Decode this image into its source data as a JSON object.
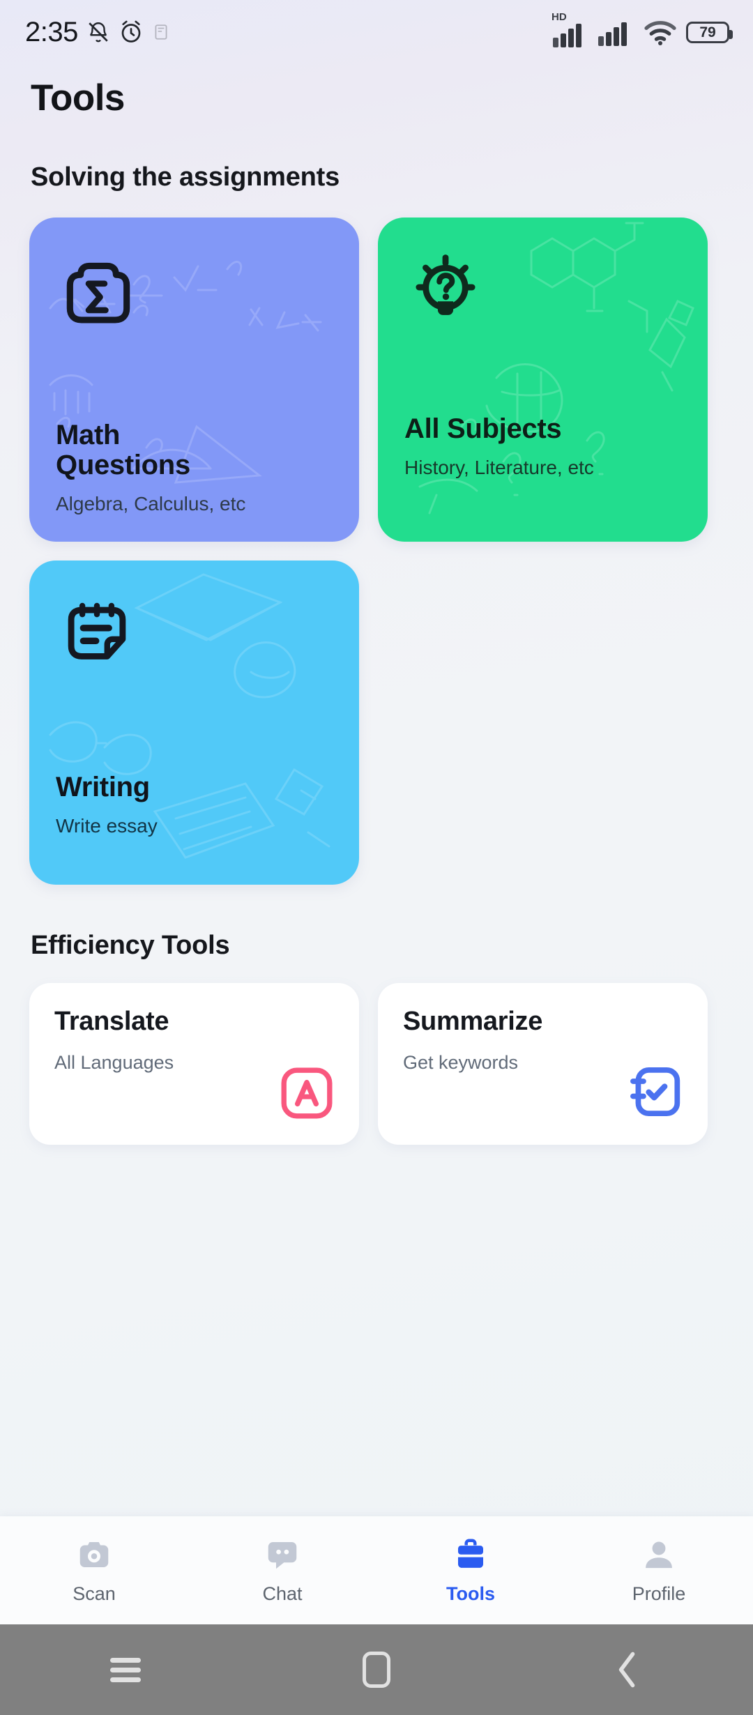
{
  "status_bar": {
    "time": "2:35",
    "icons_left": [
      "mute-icon",
      "alarm-icon",
      "screenshot-icon"
    ],
    "network_label": "HD",
    "icons_right": [
      "signal-icon",
      "signal-icon",
      "wifi-icon"
    ],
    "battery_level": "79"
  },
  "header": {
    "title": "Tools"
  },
  "sections": {
    "solving": {
      "title": "Solving the assignments"
    },
    "efficiency": {
      "title": "Efficiency Tools"
    }
  },
  "tool_cards": [
    {
      "title": "Math Questions",
      "title_line1": "Math",
      "title_line2": "Questions",
      "subtitle": "Algebra, Calculus, etc",
      "icon": "camera-sigma-icon",
      "color": "#8298f7"
    },
    {
      "title": "All Subjects",
      "subtitle": "History, Literature, etc",
      "icon": "lightbulb-question-icon",
      "color": "#22dd8e"
    },
    {
      "title": "Writing",
      "subtitle": "Write essay",
      "icon": "notepad-icon",
      "color": "#51c9f8"
    }
  ],
  "efficiency_cards": [
    {
      "title": "Translate",
      "subtitle": "All Languages",
      "icon": "letter-a-box-icon",
      "color": "#f9577e"
    },
    {
      "title": "Summarize",
      "subtitle": "Get keywords",
      "icon": "notebook-check-icon",
      "color": "#4b72ef"
    }
  ],
  "bottom_tabs": [
    {
      "label": "Scan",
      "icon": "camera-icon",
      "active": false
    },
    {
      "label": "Chat",
      "icon": "chat-bubble-icon",
      "active": false
    },
    {
      "label": "Tools",
      "icon": "toolbox-icon",
      "active": true
    },
    {
      "label": "Profile",
      "icon": "person-icon",
      "active": false
    }
  ],
  "system_nav": [
    {
      "icon": "menu-icon"
    },
    {
      "icon": "home-icon"
    },
    {
      "icon": "back-icon"
    }
  ],
  "colors": {
    "accent": "#2a5bf0",
    "math_card": "#8298f7",
    "subjects_card": "#22dd8e",
    "writing_card": "#51c9f8",
    "translate_icon": "#f9577e",
    "summarize_icon": "#4b72ef",
    "page_bg": "#f1f4f7"
  }
}
